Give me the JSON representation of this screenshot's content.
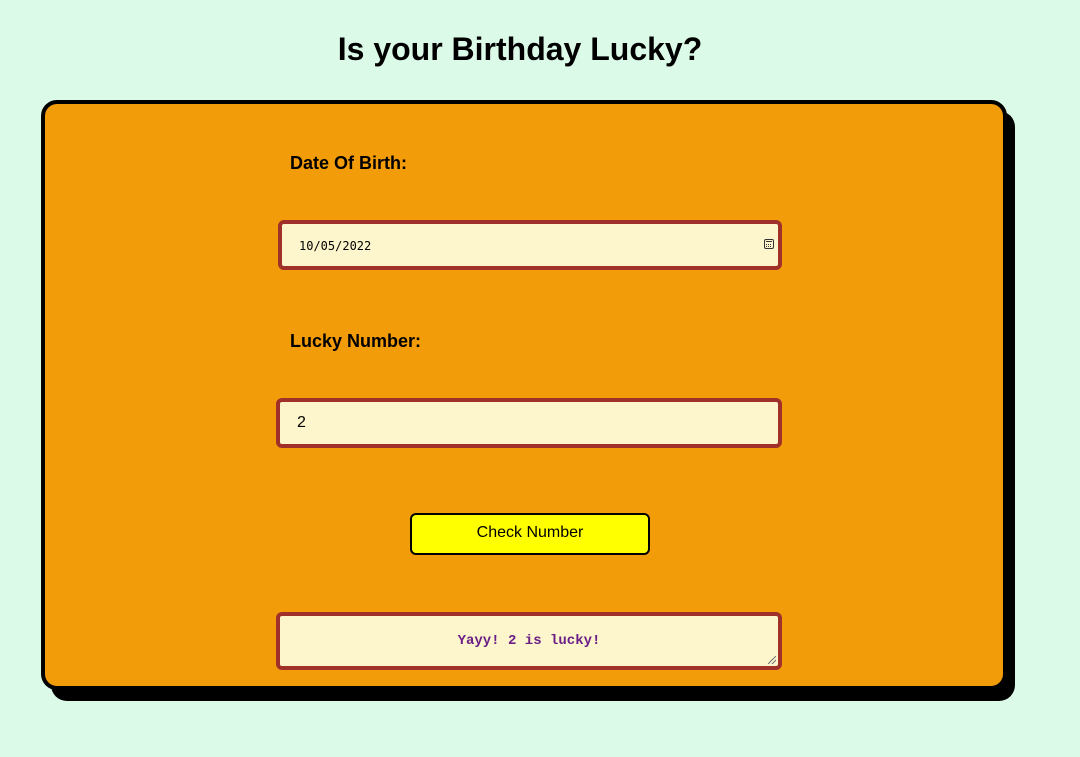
{
  "page": {
    "title": "Is your Birthday Lucky?"
  },
  "form": {
    "dob_label": "Date Of Birth:",
    "dob_value": "10/05/2022",
    "lucky_label": "Lucky Number:",
    "lucky_value": "2",
    "check_button_label": "Check Number",
    "output_text": "Yayy! 2 is lucky!"
  },
  "icons": {
    "date_picker": "calendar-icon",
    "textarea_resize": "resize-grip-icon"
  },
  "colors": {
    "background": "#dcfae8",
    "card": "#f39c0a",
    "field_bg": "#fdf6cd",
    "field_border": "#a0302a",
    "button": "#ffff00",
    "output_text": "#6b1f86"
  }
}
